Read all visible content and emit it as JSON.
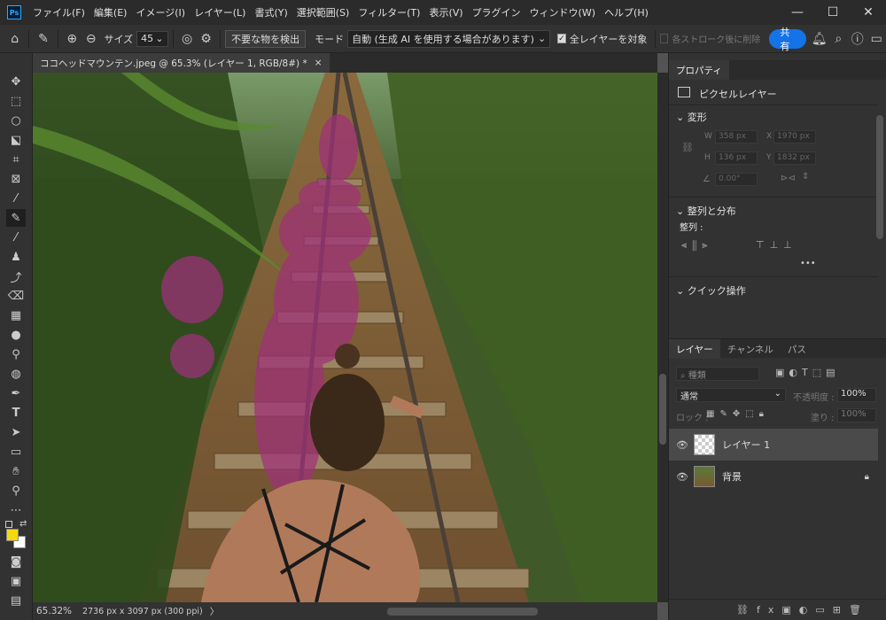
{
  "app": {
    "logo": "Ps"
  },
  "menu": [
    "ファイル(F)",
    "編集(E)",
    "イメージ(I)",
    "レイヤー(L)",
    "書式(Y)",
    "選択範囲(S)",
    "フィルター(T)",
    "表示(V)",
    "プラグイン",
    "ウィンドウ(W)",
    "ヘルプ(H)"
  ],
  "window_controls": {
    "minimize": "—",
    "maximize": "☐",
    "close": "✕"
  },
  "options": {
    "size_label": "サイズ",
    "size_value": "45",
    "detect_button": "不要な物を検出",
    "mode_label": "モード",
    "mode_value": "自動 (生成 AI を使用する場合があります)",
    "all_layers_label": "全レイヤーを対象",
    "delete_after_stroke": "各ストローク後に削除",
    "share_button": "共有"
  },
  "document": {
    "tab_title": "ココヘッドマウンテン.jpeg @ 65.3% (レイヤー 1, RGB/8#) *",
    "tab_close": "×",
    "zoom": "65.32%",
    "dimensions": "2736 px x 3097 px (300 ppi)",
    "status_arrow": "〉"
  },
  "properties": {
    "tab_label": "プロパティ",
    "pixel_layer_label": "ピクセルレイヤー",
    "transform_heading": "変形",
    "w_label": "W",
    "w_value": "358 px",
    "h_label": "H",
    "h_value": "136 px",
    "x_label": "X",
    "x_value": "1970 px",
    "y_label": "Y",
    "y_value": "1832 px",
    "angle_value": "0.00°",
    "align_heading": "整列と分布",
    "align_label": "整列 :",
    "more": "•••",
    "quick_actions_heading": "クイック操作"
  },
  "layers_panel": {
    "tabs": [
      "レイヤー",
      "チャンネル",
      "パス"
    ],
    "search_placeholder": "種類",
    "blend_mode": "通常",
    "opacity_label": "不透明度 :",
    "opacity_value": "100%",
    "lock_label": "ロック :",
    "fill_label": "塗り :",
    "fill_value": "100%",
    "layers": [
      {
        "name": "レイヤー 1",
        "selected": true,
        "locked": false
      },
      {
        "name": "背景",
        "selected": false,
        "locked": true
      }
    ]
  },
  "colors": {
    "foreground": "#f5d90a",
    "background": "#ffffff",
    "accent": "#1473e6",
    "mask_overlay": "#a0307a"
  }
}
